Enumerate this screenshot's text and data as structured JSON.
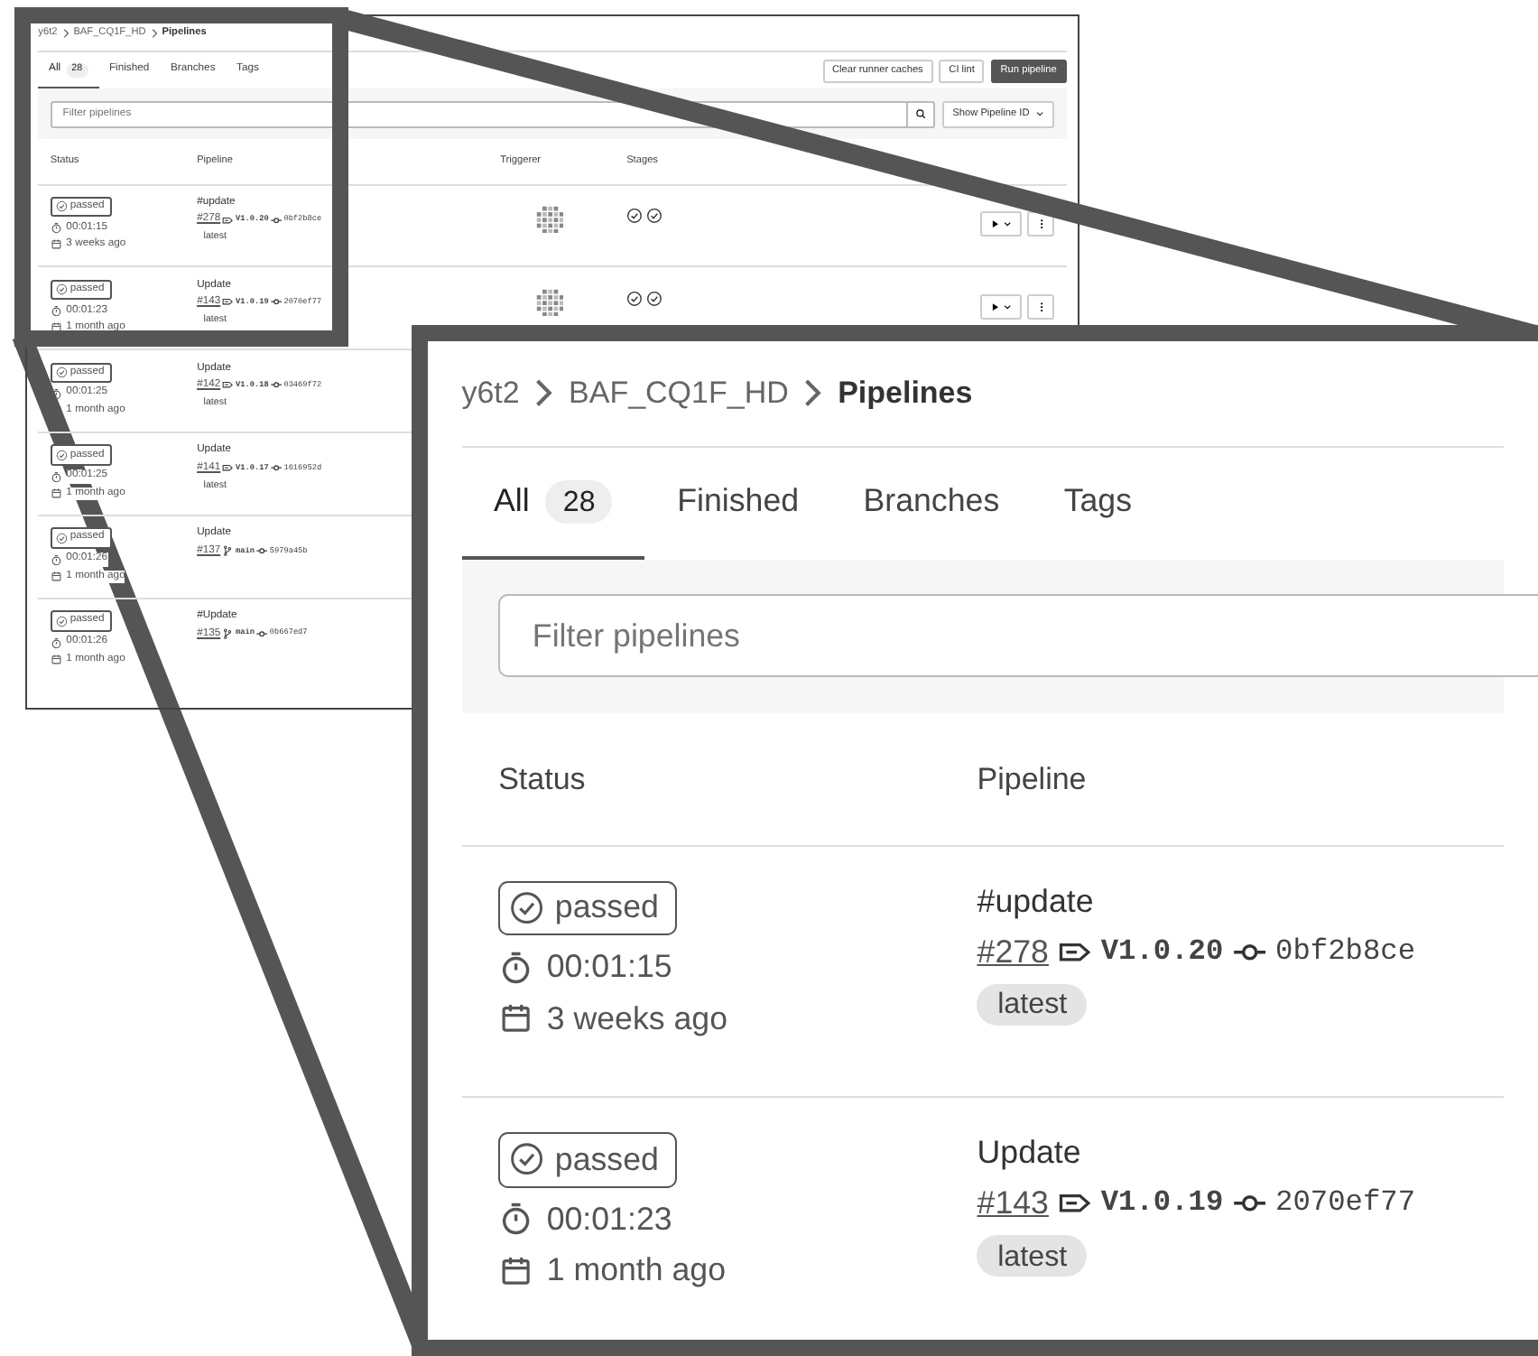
{
  "overview": {
    "breadcrumb": [
      "y6t2",
      "BAF_CQ1F_HD",
      "Pipelines"
    ],
    "tabs": [
      {
        "label": "All",
        "count": "28",
        "selected": true
      },
      {
        "label": "Finished",
        "selected": false
      },
      {
        "label": "Branches",
        "selected": false
      },
      {
        "label": "Tags",
        "selected": false
      }
    ],
    "buttons": [
      {
        "label": "Clear runner caches",
        "kind": "secondary"
      },
      {
        "label": "CI lint",
        "kind": "secondary"
      },
      {
        "label": "Run pipeline",
        "kind": "primary"
      }
    ],
    "filter": {
      "placeholder": "Filter pipelines"
    },
    "id_dropdown": "Show Pipeline ID",
    "columns": [
      "Status",
      "Pipeline",
      "Triggerer",
      "Stages"
    ],
    "rows": [
      {
        "status": "passed",
        "duration": "00:01:15",
        "created": "3 weeks ago",
        "title": "#update",
        "id": "#278",
        "kind": "tag",
        "ref": "V1.0.20",
        "commit": "0bf2b8ce",
        "badge": "latest",
        "stages": [
          {
            "passed": true
          },
          {
            "passed": true
          }
        ]
      },
      {
        "status": "passed",
        "duration": "00:01:23",
        "created": "1 month ago",
        "title": "Update",
        "id": "#143",
        "kind": "tag",
        "ref": "V1.0.19",
        "commit": "2070ef77",
        "badge": "latest",
        "stages": [
          {
            "passed": true
          },
          {
            "passed": true
          }
        ]
      },
      {
        "status": "passed",
        "duration": "00:01:25",
        "created": "1 month ago",
        "title": "Update",
        "id": "#142",
        "kind": "tag",
        "ref": "V1.0.18",
        "commit": "03469f72",
        "badge": "latest"
      },
      {
        "status": "passed",
        "duration": "00:01:25",
        "created": "1 month ago",
        "title": "Update",
        "id": "#141",
        "kind": "tag",
        "ref": "V1.0.17",
        "commit": "1616952d",
        "badge": "latest"
      },
      {
        "status": "passed",
        "duration": "00:01:26",
        "created": "1 month ago",
        "title": "Update",
        "id": "#137",
        "kind": "branch",
        "ref": "main",
        "commit": "5979a45b"
      },
      {
        "status": "passed",
        "duration": "00:01:26",
        "created": "1 month ago",
        "title": "#Update",
        "id": "#135",
        "kind": "branch",
        "ref": "main",
        "commit": "0b667ed7"
      }
    ]
  },
  "zoom": {
    "breadcrumb": [
      "y6t2",
      "BAF_CQ1F_HD",
      "Pipelines"
    ],
    "tabs": [
      {
        "label": "All",
        "count": "28",
        "selected": true
      },
      {
        "label": "Finished",
        "selected": false
      },
      {
        "label": "Branches",
        "selected": false
      },
      {
        "label": "Tags",
        "selected": false
      }
    ],
    "filter": {
      "placeholder": "Filter pipelines"
    },
    "columns": [
      "Status",
      "Pipeline"
    ],
    "rows": [
      {
        "status": "passed",
        "duration": "00:01:15",
        "created": "3 weeks ago",
        "title": "#update",
        "id": "#278",
        "kind": "tag",
        "ref": "V1.0.20",
        "commit": "0bf2b8ce",
        "badge": "latest"
      },
      {
        "status": "passed",
        "duration": "00:01:23",
        "created": "1 month ago",
        "title": "Update",
        "id": "#143",
        "kind": "tag",
        "ref": "V1.0.19",
        "commit": "2070ef77",
        "badge": "latest"
      }
    ]
  }
}
